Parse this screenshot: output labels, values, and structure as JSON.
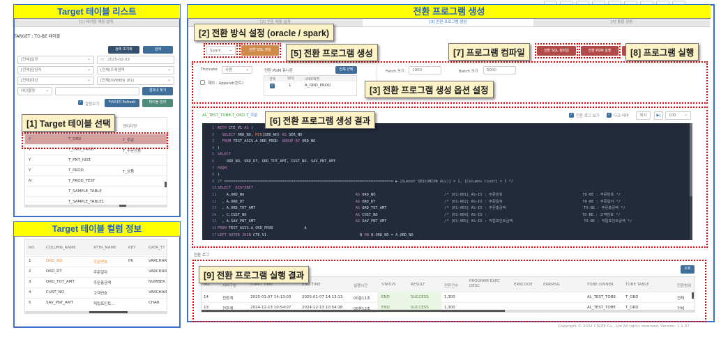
{
  "left": {
    "list_title": "Target 테이블 리스트",
    "tab": "[1] 테이블 매핑 설계",
    "heading": "TARGET : TO-BE 테이블",
    "reset_button": "검색 초기화",
    "search_button": "검색",
    "filters": {
      "schedule": "[전체]일정",
      "date": "2025-02-03",
      "manager": "[전체]담당자",
      "subject": "[전체]주제영역",
      "target": "[전체]대상",
      "owner": "[전체]OWNER (81)",
      "table_name": "테이블명",
      "keyword": ""
    },
    "find_in_results": "결과내 찾기",
    "column_view": "칼럼보기",
    "dict_refresh": "딕셔너리 Refresh",
    "table_manage": "테이블 관리",
    "table_header_entity": "엔티티명",
    "tables": [
      [
        "Y",
        "T_ORD",
        "T_주문"
      ],
      [
        "Y",
        "T_ORD_PROD",
        "T_주문상품"
      ],
      [
        "Y",
        "T_PNT_HIST",
        ""
      ],
      [
        "Y",
        "T_PROD",
        "T_상품"
      ],
      [
        "N",
        "T_PROD_TEST",
        ""
      ],
      [
        "",
        "T_SAMPLE_TABLE",
        ""
      ],
      [
        "",
        "T_SAMPLE_TABLE1",
        ""
      ]
    ],
    "col_title": "Target 테이블 컬럼 정보",
    "col_headers": [
      "NO",
      "COLUMN_NAME",
      "ATTR_NAME",
      "KEY",
      "DATA_TY"
    ],
    "columns": [
      [
        "1",
        "ORD_NO",
        "주문번호",
        "PK",
        "VARCHAR"
      ],
      [
        "2",
        "ORD_DT",
        "주문일자",
        "",
        "VARCHAR"
      ],
      [
        "3",
        "ORD_TOT_AMT",
        "주문총금액",
        "",
        "NUMBER"
      ],
      [
        "4",
        "CUST_NO",
        "고객번호",
        "",
        "VARCHAR"
      ],
      [
        "5",
        "SAV_PNT_AMT",
        "적립포인트...",
        "",
        "CHAR"
      ]
    ]
  },
  "main": {
    "title": "전환 프로그램 생성",
    "tabs": [
      {
        "label": "[2] 전환 매핑 설계"
      },
      {
        "label": "[3] 전환 프로그램 생성"
      },
      {
        "label": "[4] 통합 검증"
      }
    ],
    "mode": "Spark",
    "gen_sql": "전환 SQL 생성",
    "compile_sql": "전환 SQL 컴파일",
    "run_pgm": "전환 PGM 실행",
    "options": {
      "truncate_label": "Truncate",
      "truncate_value": "사용",
      "append_label": "제외 : Append(힌트)",
      "union_label": "전환 PGM 유니온",
      "select_all": "전체 선택",
      "union_headers": [
        "선택",
        "SEQ",
        "UNION명"
      ],
      "union_rows": [
        [
          "1",
          "A_ORD_PROD"
        ]
      ],
      "fetch_label": "Fetch 크기",
      "fetch_value": "1000",
      "batch_label": "Batch 크기",
      "batch_value": "5000"
    },
    "result": {
      "table_name": "AL_TEST_TOBE.T_ORD",
      "entity": "T_주문",
      "show_log": "전환 로그 보기",
      "dark_theme": "다크 테마",
      "copy": "복사",
      "lines_value": "100"
    },
    "code": [
      "WITH CTE_V1 AS (",
      "  SELECT ORD_NO, MIN(SER_NO) AS SER_NO",
      "  FROM TEST_ASIS.A_ORD_PROD  GROUP BY ORD_NO",
      ")",
      "SELECT",
      "    ORD_NO, ORD_DT, ORD_TOT_AMT, CUST_NO, SAV_PNT_AMT",
      "FROM",
      "(",
      "/* ============================================================================ ▶ [Subset SEQ(UNION ALL)] = 1, [Columns Count] = 5 */",
      "SELECT  DISTINCT",
      "    A.ORD_NO                                                  AS ORD_NO                               /* [01-001] AS-IS : 주문번호                                    TO-BE : 주문번호 */",
      "  , A.ORD_DT                                                  AS ORD_DT                               /* [01-002] AS-IS : 주문일자                                    TO-BE : 주문일자 */",
      "  , A.ORD_TOT_AMT                                             AS ORD_TOT_AMT                          /* [01-003] AS-IS : 주문총금액                                   TO-BE : 주문총금액 */",
      "  , C.CUST_NO                                                 AS CUST_NO                              /* [01-004] AS-IS :                                           TO-BE : 고객번호 */",
      "  , A.SAV_PNT_AMT                                             AS SAV_PNT_AMT                          /* [01-005] AS-IS : 적립포인트금액                                TO-BE : 적립포인트금액 */",
      "FROM TEST_ASIS.A_ORD_PROD              A",
      "LEFT OUTER JOIN CTE_V1                                          B ON B.ORD_NO = A.ORD_NO"
    ],
    "log_label": "전환 로그",
    "query_button": "조회",
    "exec_headers": [
      "NO",
      "서버구분",
      "START TIME",
      "END TIME",
      "실행시간",
      "STATUS",
      "RESULT",
      "전환건수",
      "PROGRAM EXEC DESC",
      "ERRCODE",
      "ERRMSG",
      "TOBE OWNER",
      "TOBE TABLE",
      "전환범위"
    ],
    "exec_rows": [
      [
        "14",
        "전환계",
        "2025-01-07 14:13:03",
        "2025-01-07 14:13:13",
        "00분11초",
        "END",
        "SUCCESS",
        "1,300",
        "",
        "",
        "",
        "AL_TEST_TOBE",
        "T_ORD",
        "전체"
      ],
      [
        "13",
        "전환계",
        "2024-12-13 10:54:07",
        "2024-12-13 10:54:18",
        "00분12초",
        "END",
        "SUCCESS",
        "1,300",
        "",
        "",
        "",
        "AL_TEST_TOBE",
        "T_ORD",
        "전체"
      ]
    ],
    "copyright": "Copyright © 2022 CSLEE Co., Ltd All rights reserved.    Version: 1.1.37"
  },
  "callouts": {
    "c1": "[1] Target 테이블 선택",
    "c2": "[2] 전환 방식 설정 (oracle / spark)",
    "c3": "[3] 전환 프로그램 생성 옵션 설정",
    "c5": "[5] 전환 프로그램 생성",
    "c6": "[6] 전환 프로그램 생성 결과",
    "c7": "[7] 프로그램 컴파일",
    "c8": "[8] 프로그램 실행",
    "c9": "[9] 전환 프로그램 실행 결과"
  },
  "colors": {
    "highlight_row": "#d4a0a0",
    "orange_button": "#d08a4a",
    "red_button": "#b24a4a",
    "editor_bg": "#222b3a",
    "annotation_yellow": "#ffff00",
    "annotation_blue": "#3b6fc9"
  }
}
